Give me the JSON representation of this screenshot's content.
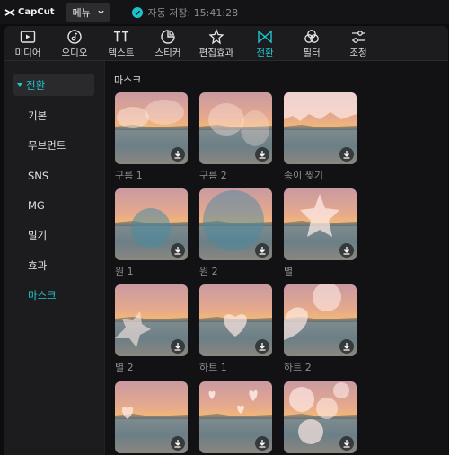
{
  "app": {
    "name": "CapCut"
  },
  "topbar": {
    "menu_label": "메뉴",
    "save_status": "자동 저장: 15:41:28"
  },
  "tabs": [
    {
      "label": "미디어",
      "icon": "media-icon"
    },
    {
      "label": "오디오",
      "icon": "audio-icon"
    },
    {
      "label": "텍스트",
      "icon": "text-icon"
    },
    {
      "label": "스티커",
      "icon": "sticker-icon"
    },
    {
      "label": "편집효과",
      "icon": "effects-icon"
    },
    {
      "label": "전환",
      "icon": "transition-icon"
    },
    {
      "label": "필터",
      "icon": "filter-icon"
    },
    {
      "label": "조정",
      "icon": "adjust-icon"
    }
  ],
  "active_tab": "전환",
  "sidebar": {
    "header": "전환",
    "items": [
      {
        "label": "기본"
      },
      {
        "label": "무브먼트"
      },
      {
        "label": "SNS"
      },
      {
        "label": "MG"
      },
      {
        "label": "밀기"
      },
      {
        "label": "효과"
      },
      {
        "label": "마스크"
      }
    ],
    "active_item": "마스크"
  },
  "content": {
    "section_title": "마스크",
    "cards": [
      {
        "label": "구름 1"
      },
      {
        "label": "구름 2"
      },
      {
        "label": "종이 찢기"
      },
      {
        "label": "원 1"
      },
      {
        "label": "원 2"
      },
      {
        "label": "별"
      },
      {
        "label": "별 2"
      },
      {
        "label": "하트 1"
      },
      {
        "label": "하트 2"
      },
      {
        "label": ""
      },
      {
        "label": ""
      },
      {
        "label": ""
      }
    ]
  },
  "colors": {
    "accent": "#22c6d0",
    "panel": "#1c1c1e",
    "content_bg": "#121214"
  }
}
